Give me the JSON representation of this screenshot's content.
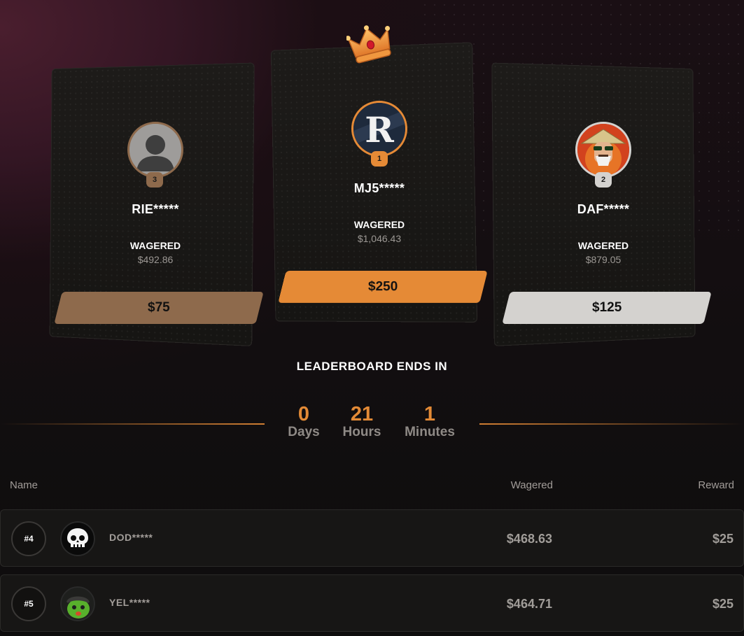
{
  "podium": {
    "first": {
      "rank": "1",
      "name": "MJ5*****",
      "wagered_label": "WAGERED",
      "wagered": "$1,046.43",
      "prize": "$250",
      "color": "#e58a36",
      "avatar": "letter-r-avatar"
    },
    "second": {
      "rank": "2",
      "name": "DAF*****",
      "wagered_label": "WAGERED",
      "wagered": "$879.05",
      "prize": "$125",
      "color": "#d4d2cf",
      "avatar": "samurai-avatar"
    },
    "third": {
      "rank": "3",
      "name": "RIE*****",
      "wagered_label": "WAGERED",
      "wagered": "$492.86",
      "prize": "$75",
      "color": "#8e6a4c",
      "avatar": "default-user-avatar"
    }
  },
  "countdown": {
    "title": "LEADERBOARD ENDS IN",
    "days": "0",
    "days_label": "Days",
    "hours": "21",
    "hours_label": "Hours",
    "minutes": "1",
    "minutes_label": "Minutes"
  },
  "table": {
    "headers": {
      "name": "Name",
      "wagered": "Wagered",
      "reward": "Reward"
    },
    "rows": [
      {
        "rank": "#4",
        "name": "DOD*****",
        "wagered": "$468.63",
        "reward": "$25",
        "avatar": "skull-avatar"
      },
      {
        "rank": "#5",
        "name": "YEL*****",
        "wagered": "$464.71",
        "reward": "$25",
        "avatar": "green-creature-avatar"
      }
    ]
  },
  "colors": {
    "accent": "#e58a36",
    "background": "#120e10",
    "card": "#1a1917"
  }
}
